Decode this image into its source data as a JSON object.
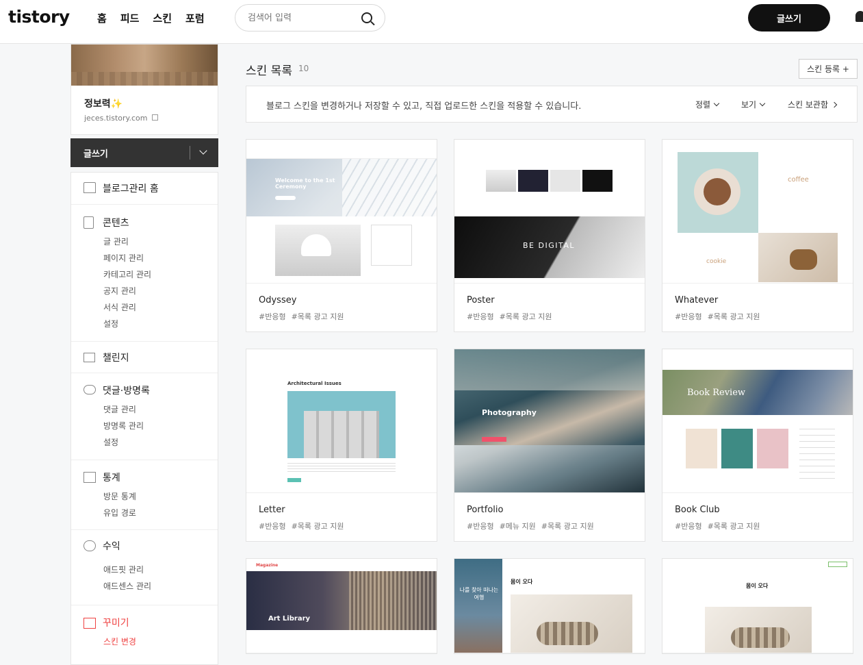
{
  "header": {
    "logo": "tistory",
    "nav": [
      "홈",
      "피드",
      "스킨",
      "포럼"
    ],
    "search_placeholder": "검색어 입력",
    "write_label": "글쓰기"
  },
  "profile": {
    "name": "정보력✨",
    "url": "jeces.tistory.com"
  },
  "sidebar": {
    "write_label": "글쓰기",
    "home": "블로그관리 홈",
    "content": {
      "title": "콘텐츠",
      "items": [
        "글 관리",
        "페이지 관리",
        "카테고리 관리",
        "공지 관리",
        "서식 관리",
        "설정"
      ]
    },
    "challenge": "챌린지",
    "comments": {
      "title": "댓글·방명록",
      "items": [
        "댓글 관리",
        "방명록 관리",
        "설정"
      ]
    },
    "stats": {
      "title": "통계",
      "items": [
        "방문 통계",
        "유입 경로"
      ]
    },
    "revenue": {
      "title": "수익",
      "items": [
        "애드핏 관리",
        "애드센스 관리"
      ]
    },
    "decorate": {
      "title": "꾸미기",
      "items": [
        "스킨 변경"
      ]
    }
  },
  "main": {
    "title": "스킨 목록",
    "count": "10",
    "register_label": "스킨 등록 +",
    "info": "블로그 스킨을 변경하거나 저장할 수 있고, 직접 업로드한 스킨을 적용할 수 있습니다.",
    "sort_label": "정렬",
    "view_label": "보기",
    "storage_label": "스킨 보관함"
  },
  "skins": [
    {
      "name": "Odyssey",
      "tags": [
        "#반응형",
        "#목록 광고 지원"
      ],
      "preview_title": "Welcome to the 1st Ceremony"
    },
    {
      "name": "Poster",
      "tags": [
        "#반응형",
        "#목록 광고 지원"
      ],
      "preview_title": "BE DIGITAL"
    },
    {
      "name": "Whatever",
      "tags": [
        "#반응형",
        "#목록 광고 지원"
      ],
      "preview_title": "coffee",
      "preview_sub": "cookie"
    },
    {
      "name": "Letter",
      "tags": [
        "#반응형",
        "#목록 광고 지원"
      ],
      "preview_title": "Architectural Issues"
    },
    {
      "name": "Portfolio",
      "tags": [
        "#반응형",
        "#메뉴 지원",
        "#목록 광고 지원"
      ],
      "preview_title": "Photography"
    },
    {
      "name": "Book Club",
      "tags": [
        "#반응형",
        "#목록 광고 지원"
      ],
      "preview_title": "Book Review"
    },
    {
      "name": "Magazine",
      "tags": [],
      "preview_title": "Art Library"
    },
    {
      "name": "",
      "tags": [],
      "preview_title": "몸이 오다",
      "preview_sub": "나를 찾아 떠나는 여행"
    },
    {
      "name": "",
      "tags": [],
      "preview_title": "몸이 오다"
    }
  ],
  "colors": {
    "accent": "#ef4141",
    "dark": "#111111"
  }
}
